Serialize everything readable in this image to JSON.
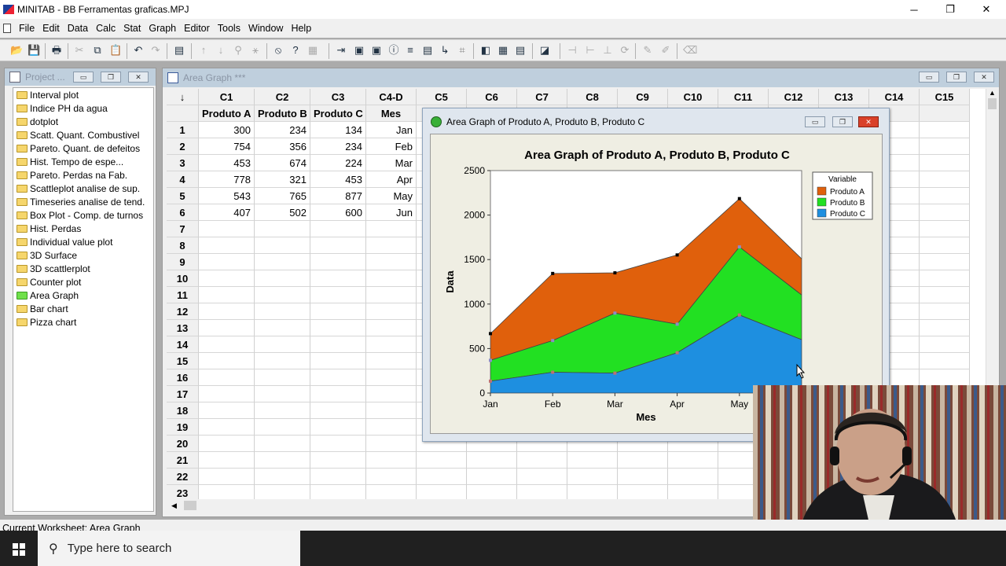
{
  "app": {
    "title": "MINITAB - BB Ferramentas graficas.MPJ",
    "menu": [
      "File",
      "Edit",
      "Data",
      "Calc",
      "Stat",
      "Graph",
      "Editor",
      "Tools",
      "Window",
      "Help"
    ]
  },
  "project": {
    "title": "Project ...",
    "items": [
      {
        "label": "Interval plot",
        "active": false
      },
      {
        "label": "Indice PH da agua",
        "active": false
      },
      {
        "label": "dotplot",
        "active": false
      },
      {
        "label": "Scatt. Quant. Combustivel",
        "active": false
      },
      {
        "label": "Pareto. Quant. de defeitos",
        "active": false
      },
      {
        "label": "Hist. Tempo de espe...",
        "active": false
      },
      {
        "label": "Pareto. Perdas na Fab.",
        "active": false
      },
      {
        "label": "Scattleplot analise de sup.",
        "active": false
      },
      {
        "label": "Timeseries analise de tend.",
        "active": false
      },
      {
        "label": "Box Plot - Comp. de turnos",
        "active": false
      },
      {
        "label": "Hist. Perdas",
        "active": false
      },
      {
        "label": "Individual value plot",
        "active": false
      },
      {
        "label": "3D Surface",
        "active": false
      },
      {
        "label": "3D scattlerplot",
        "active": false
      },
      {
        "label": "Counter plot",
        "active": false
      },
      {
        "label": "Area Graph",
        "active": true
      },
      {
        "label": "Bar chart",
        "active": false
      },
      {
        "label": "Pizza chart",
        "active": false
      }
    ]
  },
  "worksheet": {
    "title": "Area Graph ***",
    "corner": "↓",
    "columns": [
      "C1",
      "C2",
      "C3",
      "C4-D",
      "C5",
      "C6",
      "C7",
      "C8",
      "C9",
      "C10",
      "C11",
      "C12",
      "C13",
      "C14",
      "C15"
    ],
    "names": [
      "Produto A",
      "Produto B",
      "Produto C",
      "Mes",
      "",
      "",
      "",
      "",
      "",
      "",
      "",
      "",
      "",
      "",
      ""
    ],
    "rows": [
      [
        "300",
        "234",
        "134",
        "Jan"
      ],
      [
        "754",
        "356",
        "234",
        "Feb"
      ],
      [
        "453",
        "674",
        "224",
        "Mar"
      ],
      [
        "778",
        "321",
        "453",
        "Apr"
      ],
      [
        "543",
        "765",
        "877",
        "May"
      ],
      [
        "407",
        "502",
        "600",
        "Jun"
      ]
    ],
    "row_numbers": [
      "1",
      "2",
      "3",
      "4",
      "5",
      "6",
      "7",
      "8",
      "9",
      "10",
      "11",
      "12",
      "13",
      "14",
      "15",
      "16",
      "17",
      "18",
      "19",
      "20",
      "21",
      "22",
      "23"
    ]
  },
  "graph_window": {
    "title": "Area Graph of Produto A, Produto B, Produto C"
  },
  "chart_data": {
    "type": "area",
    "stacked": true,
    "title": "Area Graph of Produto A, Produto B, Produto C",
    "xlabel": "Mes",
    "ylabel": "Data",
    "categories": [
      "Jan",
      "Feb",
      "Mar",
      "Apr",
      "May",
      "Jun"
    ],
    "visible_tick_labels": [
      "Jan",
      "Feb",
      "Mar",
      "Apr",
      "May"
    ],
    "ylim": [
      0,
      2500
    ],
    "yticks": [
      0,
      500,
      1000,
      1500,
      2000,
      2500
    ],
    "legend_title": "Variable",
    "legend_position": "top-right",
    "series": [
      {
        "name": "Produto A",
        "values": [
          300,
          754,
          453,
          778,
          543,
          407
        ],
        "color": "#e0600c"
      },
      {
        "name": "Produto B",
        "values": [
          234,
          356,
          674,
          321,
          765,
          502
        ],
        "color": "#22e022"
      },
      {
        "name": "Produto C",
        "values": [
          134,
          234,
          224,
          453,
          877,
          600
        ],
        "color": "#1e8fe0"
      }
    ]
  },
  "status": {
    "text": "Current Worksheet: Area Graph"
  },
  "taskbar": {
    "search_placeholder": "Type here to search"
  }
}
